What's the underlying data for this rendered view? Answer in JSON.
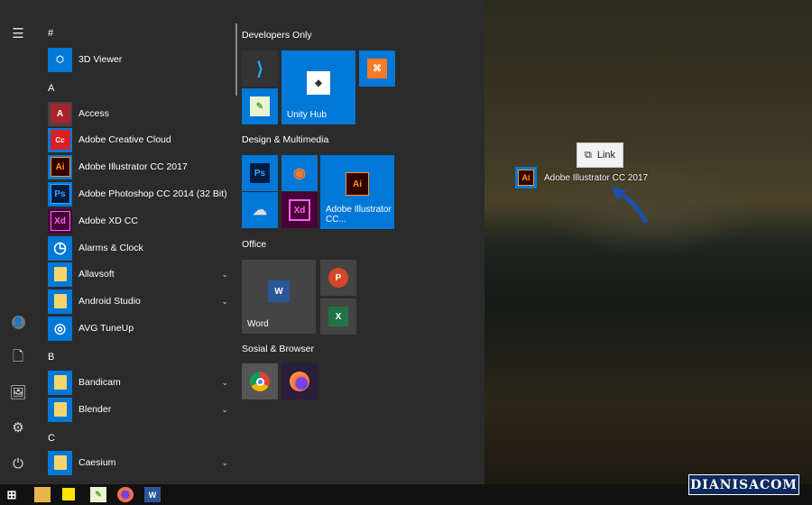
{
  "rail": {
    "items": [
      "menu-icon",
      "user-icon",
      "document-icon",
      "pictures-icon",
      "settings-icon",
      "power-icon"
    ]
  },
  "applist": {
    "letters": [
      "#",
      "A",
      "B",
      "C"
    ],
    "apps": [
      {
        "label": "3D Viewer",
        "icon": "3D",
        "color": "#0078d7"
      },
      {
        "label": "Access",
        "icon": "A",
        "color": "#a4262c"
      },
      {
        "label": "Adobe Creative Cloud",
        "icon": "Cc",
        "color": "#da1f26"
      },
      {
        "label": "Adobe Illustrator CC 2017",
        "icon": "Ai",
        "color": "#330000"
      },
      {
        "label": "Adobe Photoshop CC 2014 (32 Bit)",
        "icon": "Ps",
        "color": "#001c3f"
      },
      {
        "label": "Adobe XD CC",
        "icon": "Xd",
        "color": "#470137"
      },
      {
        "label": "Alarms & Clock",
        "icon": "◷",
        "color": "#0078d7"
      },
      {
        "label": "Allavsoft",
        "icon": "folder",
        "color": "#0078d7"
      },
      {
        "label": "Android Studio",
        "icon": "folder",
        "color": "#0078d7"
      },
      {
        "label": "AVG TuneUp",
        "icon": "◎",
        "color": "#0078d7"
      },
      {
        "label": "Bandicam",
        "icon": "folder",
        "color": "#0078d7"
      },
      {
        "label": "Blender",
        "icon": "folder",
        "color": "#0078d7"
      },
      {
        "label": "Caesium",
        "icon": "folder",
        "color": "#0078d7"
      }
    ]
  },
  "tiles": {
    "groups": [
      "Developers Only",
      "Design & Multimedia",
      "Office",
      "Sosial & Browser"
    ],
    "unity": "Unity Hub",
    "illustrator": "Adobe Illustrator CC...",
    "word": "Word",
    "small": {
      "ps": "Ps",
      "xd": "Xd",
      "ai": "Ai",
      "w": "W",
      "p": "P",
      "x": "X"
    }
  },
  "drag": {
    "label": "Adobe Illustrator CC 2017",
    "tooltip": "Link",
    "icon": "Ai"
  },
  "watermark": "DIANISACOM"
}
